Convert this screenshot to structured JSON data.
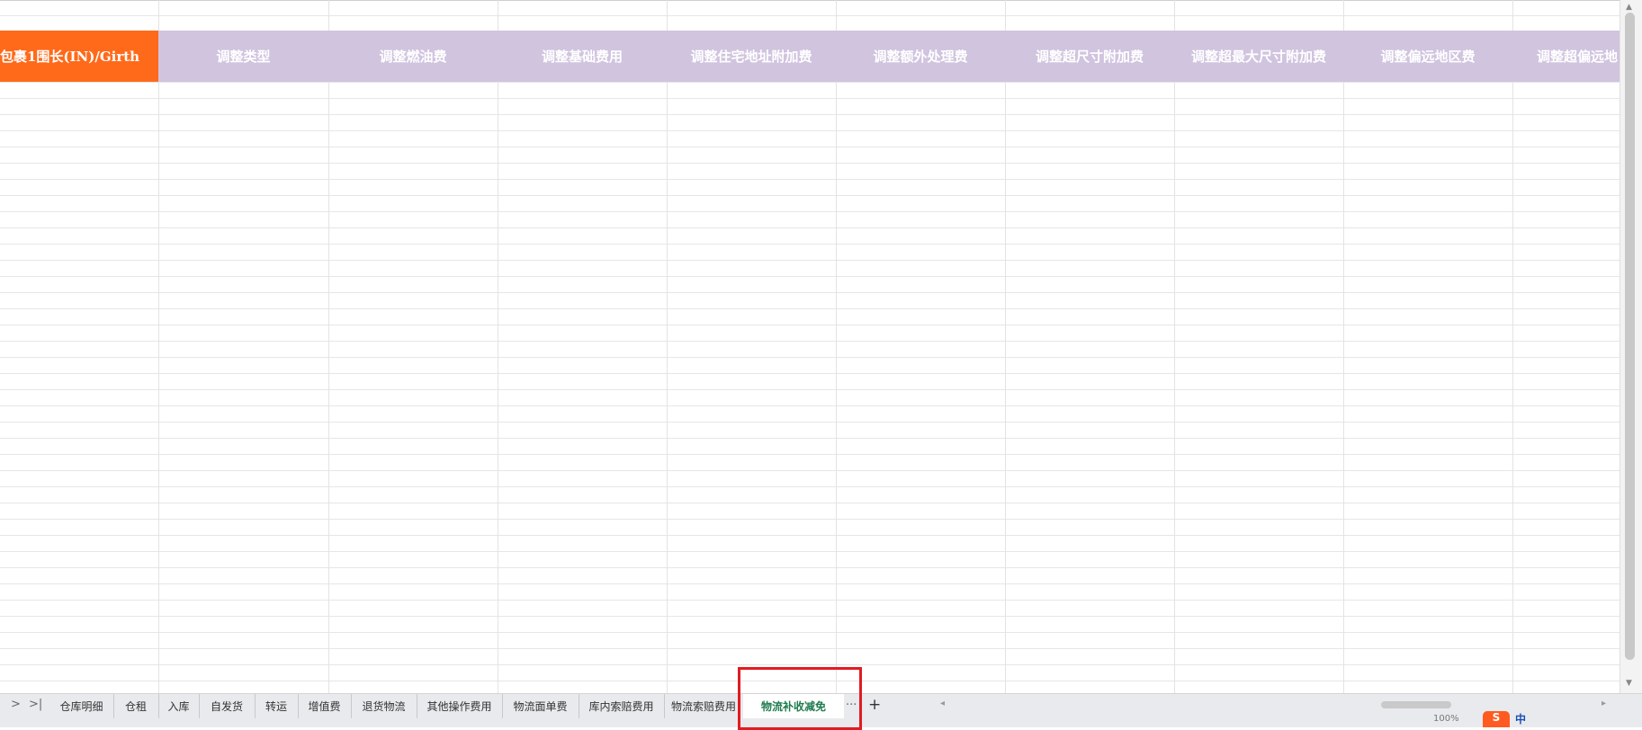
{
  "columns": [
    {
      "label": "包裹1围长(IN)/Girth",
      "color": "#ff6a1a"
    },
    {
      "label": "调整类型",
      "color": "#d1c4df"
    },
    {
      "label": "调整燃油费",
      "color": "#d1c4df"
    },
    {
      "label": "调整基础费用",
      "color": "#d1c4df"
    },
    {
      "label": "调整住宅地址附加费",
      "color": "#d1c4df"
    },
    {
      "label": "调整额外处理费",
      "color": "#d1c4df"
    },
    {
      "label": "调整超尺寸附加费",
      "color": "#d1c4df"
    },
    {
      "label": "调整超最大尺寸附加费",
      "color": "#d1c4df"
    },
    {
      "label": "调整偏远地区费",
      "color": "#d1c4df"
    },
    {
      "label": "调整超偏远地",
      "color": "#d1c4df"
    }
  ],
  "sheet_nav": {
    "next": ">",
    "last": ">|"
  },
  "sheet_tabs": [
    {
      "label": "仓库明细"
    },
    {
      "label": "仓租"
    },
    {
      "label": "入库"
    },
    {
      "label": "自发货"
    },
    {
      "label": "转运"
    },
    {
      "label": "增值费"
    },
    {
      "label": "退货物流"
    },
    {
      "label": "其他操作费用"
    },
    {
      "label": "物流面单费"
    },
    {
      "label": "库内索赔费用"
    },
    {
      "label": "物流索赔费用"
    },
    {
      "label": "物流补收减免",
      "active": true
    }
  ],
  "more_tabs": "···",
  "add_sheet": "+",
  "status": {
    "zoom": "100%",
    "ime_logo": "S",
    "ime_mode": "中"
  },
  "colors": {
    "accent_green": "#1e7b4e",
    "highlight_red": "#e11b22",
    "orange_header": "#ff6a1a",
    "lilac_header": "#d1c4df"
  },
  "icons": [
    "chevron-right-icon",
    "last-sheet-icon",
    "add-sheet-icon",
    "scroll-left-icon",
    "scroll-right-icon",
    "ime-logo-icon"
  ]
}
